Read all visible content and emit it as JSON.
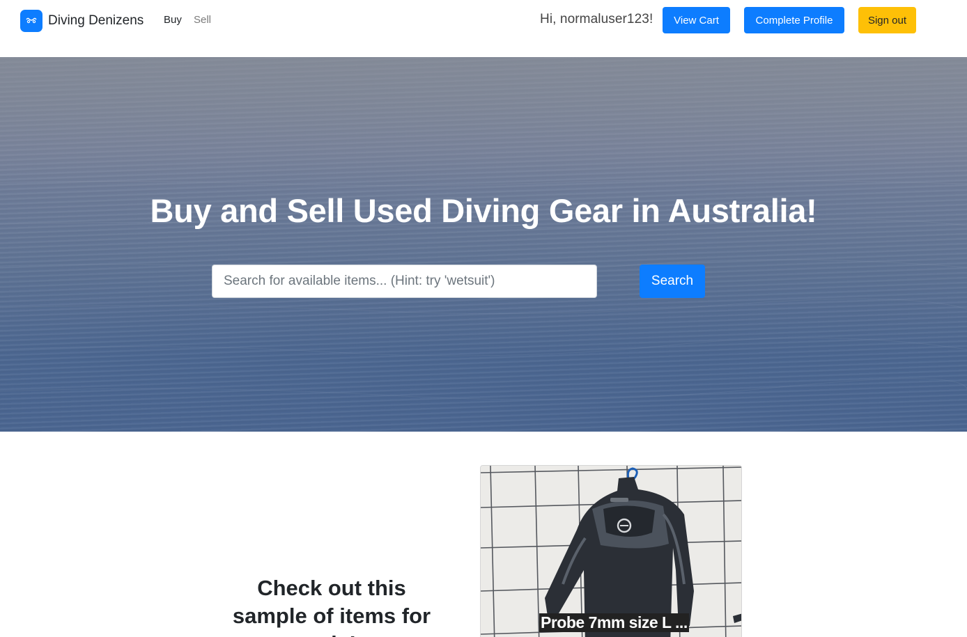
{
  "navbar": {
    "brand_name": "Diving Denizens",
    "brand_icon": "diver-mask-icon",
    "links": {
      "buy": "Buy",
      "sell": "Sell"
    },
    "greeting": "Hi, normaluser123!",
    "buttons": {
      "view_cart": "View Cart",
      "complete_profile": "Complete Profile",
      "sign_out": "Sign out"
    }
  },
  "hero": {
    "title": "Buy and Sell Used Diving Gear in Australia!",
    "search_placeholder": "Search for available items... (Hint: try 'wetsuit')",
    "search_button": "Search"
  },
  "sample": {
    "heading": "Check out this sample of items for sale!",
    "cards": [
      {
        "caption": "Probe 7mm size L ..."
      }
    ]
  },
  "colors": {
    "primary": "#0d7dff",
    "warning": "#fec007",
    "hero_sea": "#5f7394"
  }
}
